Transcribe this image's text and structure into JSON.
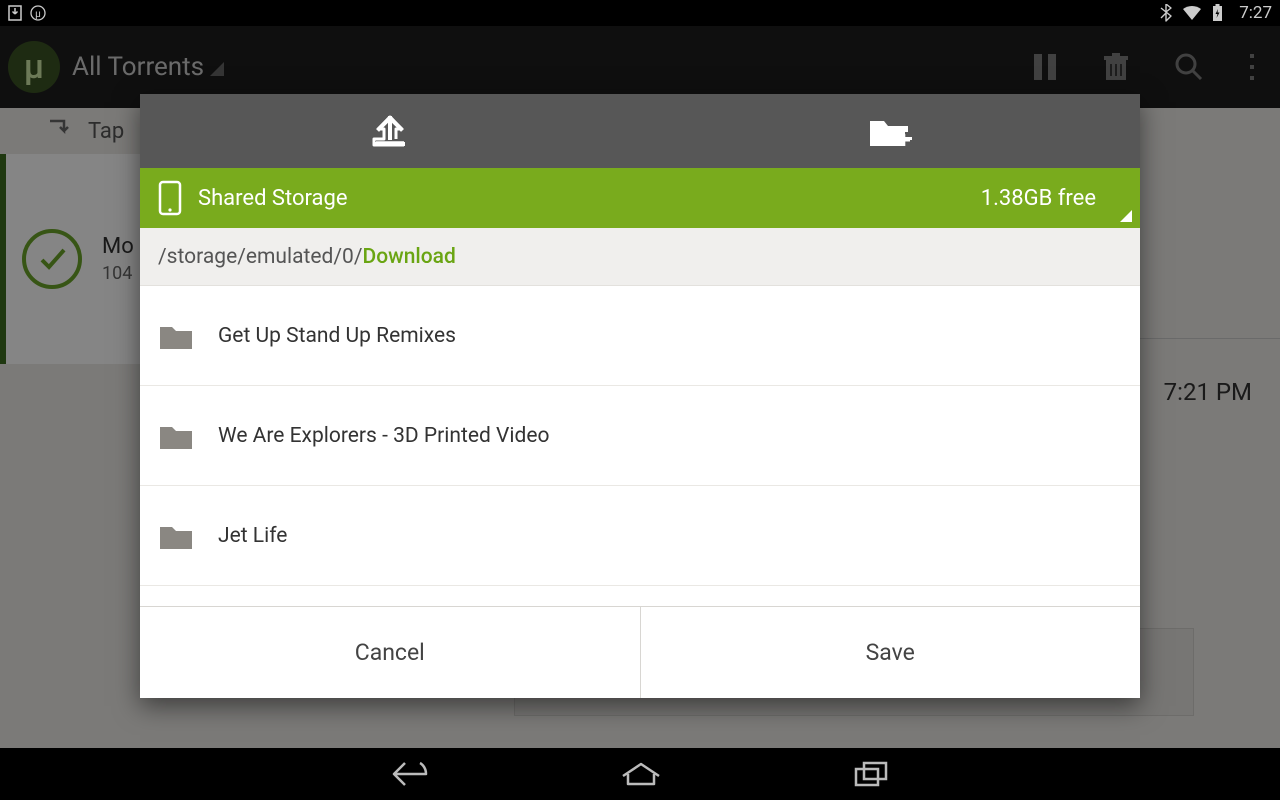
{
  "status_bar": {
    "clock": "7:27"
  },
  "app_bar": {
    "title": "All Torrents"
  },
  "hint": {
    "text": "Tap"
  },
  "card": {
    "title": "Mo",
    "sub": "104"
  },
  "detail": {
    "time": "7:21 PM",
    "path": "/storage/emulated/0/Download"
  },
  "dialog": {
    "storage_label": "Shared Storage",
    "free_space": "1.38GB free",
    "path_prefix": "/storage/emulated/0/",
    "path_active": "Download",
    "folders": [
      {
        "name": "Get Up Stand Up Remixes"
      },
      {
        "name": "We Are Explorers - 3D Printed Video"
      },
      {
        "name": "Jet Life"
      }
    ],
    "cancel": "Cancel",
    "save": "Save"
  }
}
